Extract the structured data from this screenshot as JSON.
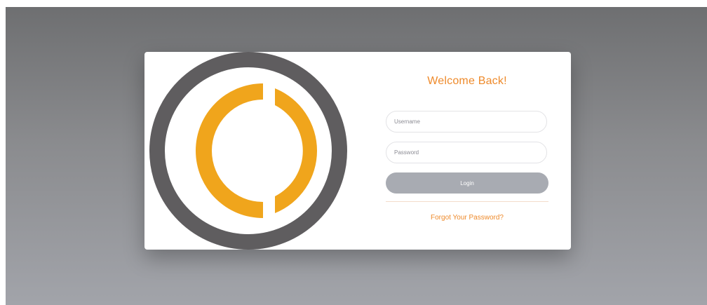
{
  "login_card": {
    "title": "Welcome Back!",
    "username_placeholder": "Username",
    "password_placeholder": "Password",
    "login_label": "Login",
    "forgot_password_label": "Forgot Your Password?"
  },
  "logo": {
    "icon": "ring-logo-icon",
    "outer_ring_color": "#5f5d5f",
    "inner_arc_color": "#f0a51c"
  },
  "colors": {
    "accent": "#ee8a2b",
    "button": "#a8abb2"
  }
}
